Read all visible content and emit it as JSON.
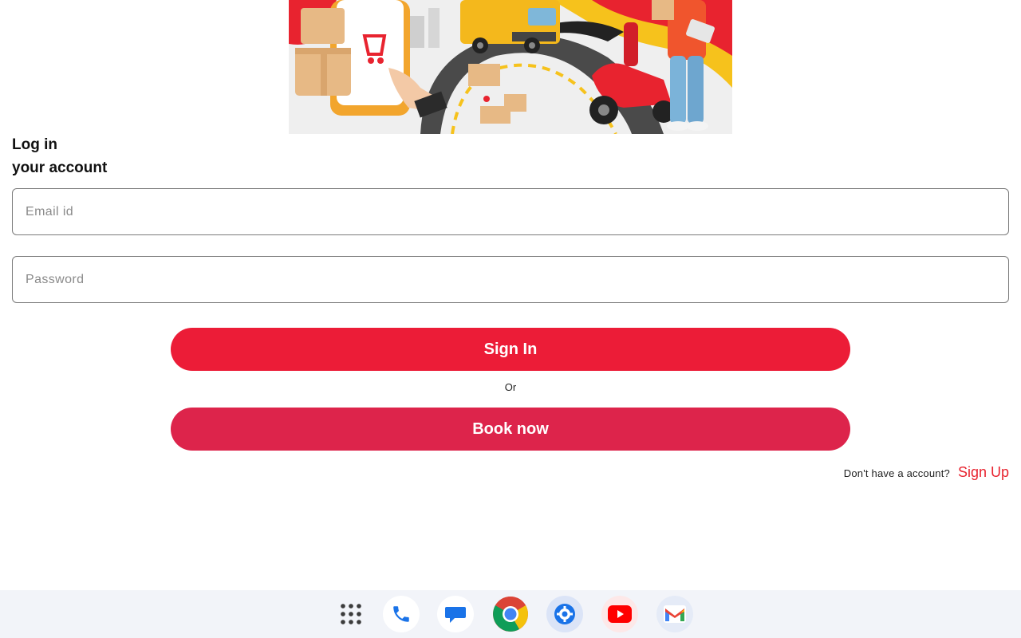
{
  "login": {
    "title_line1": "Log in",
    "title_line2": "your account",
    "email_placeholder": "Email id",
    "password_placeholder": "Password",
    "signin_label": "Sign In",
    "or_label": "Or",
    "book_label": "Book now",
    "signup_prompt": "Don't have a account?",
    "signup_link": "Sign Up"
  },
  "dock": {
    "apps": [
      "app-drawer-icon",
      "phone-icon",
      "messages-icon",
      "chrome-icon",
      "settings-icon",
      "youtube-icon",
      "gmail-icon"
    ]
  },
  "colors": {
    "signin_button": "#ec1c37",
    "book_button": "#dd244b",
    "signup_link": "#e8232f",
    "dock_background": "#f2f4f9"
  }
}
